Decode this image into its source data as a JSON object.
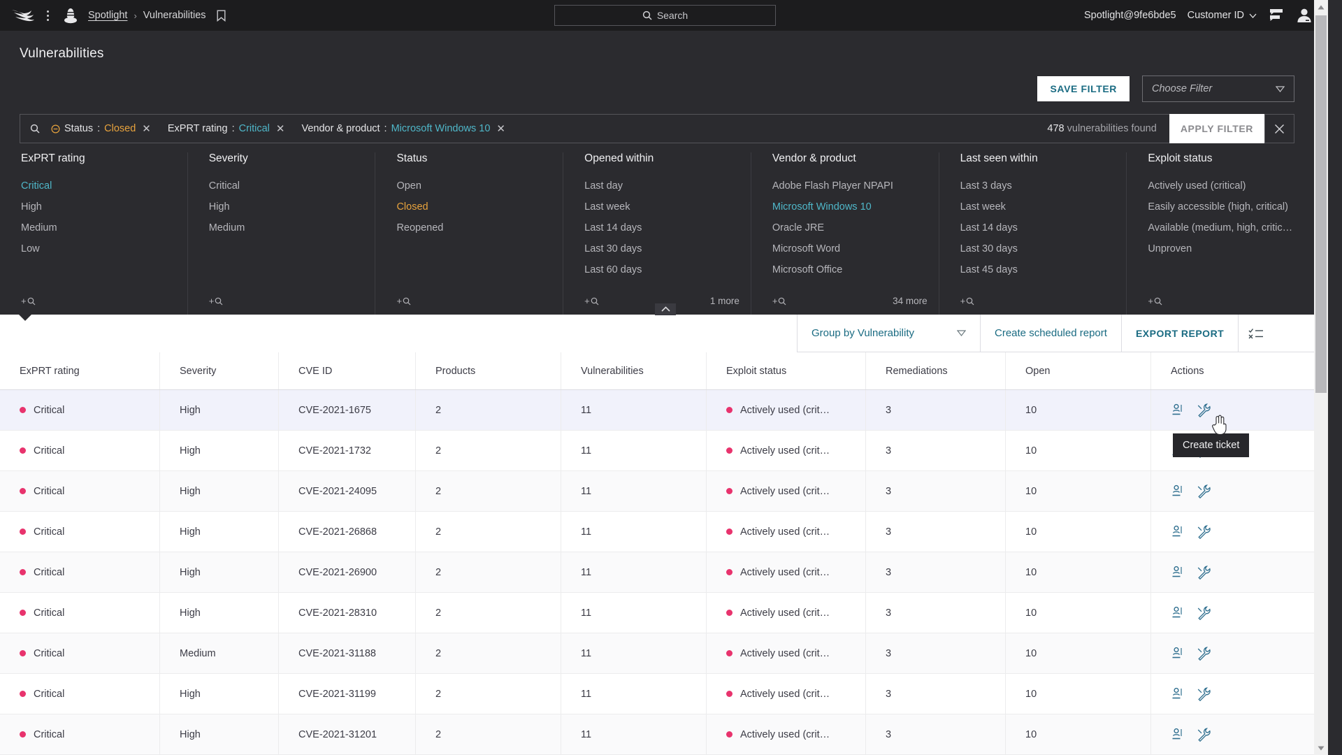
{
  "topnav": {
    "logo_icon": "falcon-logo-icon",
    "kebab_icon": "kebab-menu-icon",
    "cone_icon": "spotlight-cone-icon",
    "breadcrumb_root": "Spotlight",
    "breadcrumb_sep": "›",
    "breadcrumb_current": "Vulnerabilities",
    "bookmark_icon": "bookmark-icon",
    "search_placeholder": "Search",
    "search_icon": "search-icon",
    "user_account": "Spotlight@9fe6bde5",
    "customer_id_label": "Customer ID",
    "chevron_icon": "chevron-down-icon",
    "support_icon": "support-chat-icon",
    "avatar_icon": "user-avatar-icon"
  },
  "page": {
    "title": "Vulnerabilities"
  },
  "filter_actions": {
    "save_filter_label": "SAVE FILTER",
    "choose_filter_placeholder": "Choose Filter",
    "dropdown_icon": "triangle-down-icon"
  },
  "chipbar": {
    "search_icon": "search-icon",
    "chips": [
      {
        "key": "Status",
        "value": "Closed",
        "color": "orange",
        "has_exclude_icon": true,
        "remove_icon": "close-icon"
      },
      {
        "key": "ExPRT rating",
        "value": "Critical",
        "color": "teal",
        "has_exclude_icon": false,
        "remove_icon": "close-icon"
      },
      {
        "key": "Vendor & product",
        "value": "Microsoft Windows 10",
        "color": "teal",
        "has_exclude_icon": false,
        "remove_icon": "close-icon"
      }
    ],
    "found_count": "478",
    "found_label": "vulnerabilities found",
    "apply_filter_label": "APPLY FILTER",
    "close_icon": "close-icon"
  },
  "facets": [
    {
      "title": "ExPRT rating",
      "items": [
        {
          "label": "Critical",
          "state": "teal"
        },
        {
          "label": "High",
          "state": "none"
        },
        {
          "label": "Medium",
          "state": "none"
        },
        {
          "label": "Low",
          "state": "none"
        }
      ],
      "more": ""
    },
    {
      "title": "Severity",
      "items": [
        {
          "label": "Critical",
          "state": "none"
        },
        {
          "label": "High",
          "state": "none"
        },
        {
          "label": "Medium",
          "state": "none"
        }
      ],
      "more": ""
    },
    {
      "title": "Status",
      "items": [
        {
          "label": "Open",
          "state": "none"
        },
        {
          "label": "Closed",
          "state": "orange"
        },
        {
          "label": "Reopened",
          "state": "none"
        }
      ],
      "more": ""
    },
    {
      "title": "Opened within",
      "items": [
        {
          "label": "Last day",
          "state": "none"
        },
        {
          "label": "Last week",
          "state": "none"
        },
        {
          "label": "Last 14 days",
          "state": "none"
        },
        {
          "label": "Last 30 days",
          "state": "none"
        },
        {
          "label": "Last 60 days",
          "state": "none"
        }
      ],
      "more": "1 more"
    },
    {
      "title": "Vendor & product",
      "items": [
        {
          "label": "Adobe Flash Player NPAPI",
          "state": "none"
        },
        {
          "label": "Microsoft Windows 10",
          "state": "teal"
        },
        {
          "label": "Oracle JRE",
          "state": "none"
        },
        {
          "label": "Microsoft Word",
          "state": "none"
        },
        {
          "label": "Microsoft Office",
          "state": "none"
        }
      ],
      "more": "34 more"
    },
    {
      "title": "Last seen within",
      "items": [
        {
          "label": "Last 3 days",
          "state": "none"
        },
        {
          "label": "Last week",
          "state": "none"
        },
        {
          "label": "Last 14 days",
          "state": "none"
        },
        {
          "label": "Last 30 days",
          "state": "none"
        },
        {
          "label": "Last 45 days",
          "state": "none"
        }
      ],
      "more": ""
    },
    {
      "title": "Exploit status",
      "items": [
        {
          "label": "Actively used (critical)",
          "state": "none"
        },
        {
          "label": "Easily accessible (high, critical)",
          "state": "none"
        },
        {
          "label": "Available (medium, high, critic…",
          "state": "none"
        },
        {
          "label": "Unproven",
          "state": "none"
        }
      ],
      "more": ""
    }
  ],
  "facet_footer": {
    "add_filter_plus": "+",
    "add_filter_icon": "search-icon"
  },
  "toolbar": {
    "group_by_label": "Group by Vulnerability",
    "group_by_icon": "triangle-down-icon",
    "scheduled_report_label": "Create scheduled report",
    "export_report_label": "EXPORT REPORT",
    "columns_icon": "column-chooser-icon"
  },
  "table": {
    "columns": [
      "ExPRT rating",
      "Severity",
      "CVE ID",
      "Products",
      "Vulnerabilities",
      "Exploit status",
      "Remediations",
      "Open",
      "Actions"
    ],
    "rows": [
      {
        "exprt": "Critical",
        "severity": "High",
        "cve": "CVE-2021-1675",
        "products": "2",
        "vulns": "11",
        "exploit": "Actively used (crit…",
        "remediations": "3",
        "open": "10"
      },
      {
        "exprt": "Critical",
        "severity": "High",
        "cve": "CVE-2021-1732",
        "products": "2",
        "vulns": "11",
        "exploit": "Actively used (crit…",
        "remediations": "3",
        "open": "10"
      },
      {
        "exprt": "Critical",
        "severity": "High",
        "cve": "CVE-2021-24095",
        "products": "2",
        "vulns": "11",
        "exploit": "Actively used (crit…",
        "remediations": "3",
        "open": "10"
      },
      {
        "exprt": "Critical",
        "severity": "High",
        "cve": "CVE-2021-26868",
        "products": "2",
        "vulns": "11",
        "exploit": "Actively used (crit…",
        "remediations": "3",
        "open": "10"
      },
      {
        "exprt": "Critical",
        "severity": "High",
        "cve": "CVE-2021-26900",
        "products": "2",
        "vulns": "11",
        "exploit": "Actively used (crit…",
        "remediations": "3",
        "open": "10"
      },
      {
        "exprt": "Critical",
        "severity": "High",
        "cve": "CVE-2021-28310",
        "products": "2",
        "vulns": "11",
        "exploit": "Actively used (crit…",
        "remediations": "3",
        "open": "10"
      },
      {
        "exprt": "Critical",
        "severity": "Medium",
        "cve": "CVE-2021-31188",
        "products": "2",
        "vulns": "11",
        "exploit": "Actively used (crit…",
        "remediations": "3",
        "open": "10"
      },
      {
        "exprt": "Critical",
        "severity": "High",
        "cve": "CVE-2021-31199",
        "products": "2",
        "vulns": "11",
        "exploit": "Actively used (crit…",
        "remediations": "3",
        "open": "10"
      },
      {
        "exprt": "Critical",
        "severity": "High",
        "cve": "CVE-2021-31201",
        "products": "2",
        "vulns": "11",
        "exploit": "Actively used (crit…",
        "remediations": "3",
        "open": "10"
      }
    ],
    "row_action_icons": [
      "assign-user-icon",
      "create-ticket-wrench-icon"
    ]
  },
  "tooltip": {
    "text": "Create ticket"
  },
  "colors": {
    "accent_teal": "#1a6b82",
    "link_teal": "#4fb7c9",
    "selected_orange": "#e8a33d",
    "critical_dot": "#e8336d",
    "dark_bg": "#2b2b2f",
    "nav_bg": "#1c1c1e",
    "row_hover": "#f1f2fb"
  }
}
